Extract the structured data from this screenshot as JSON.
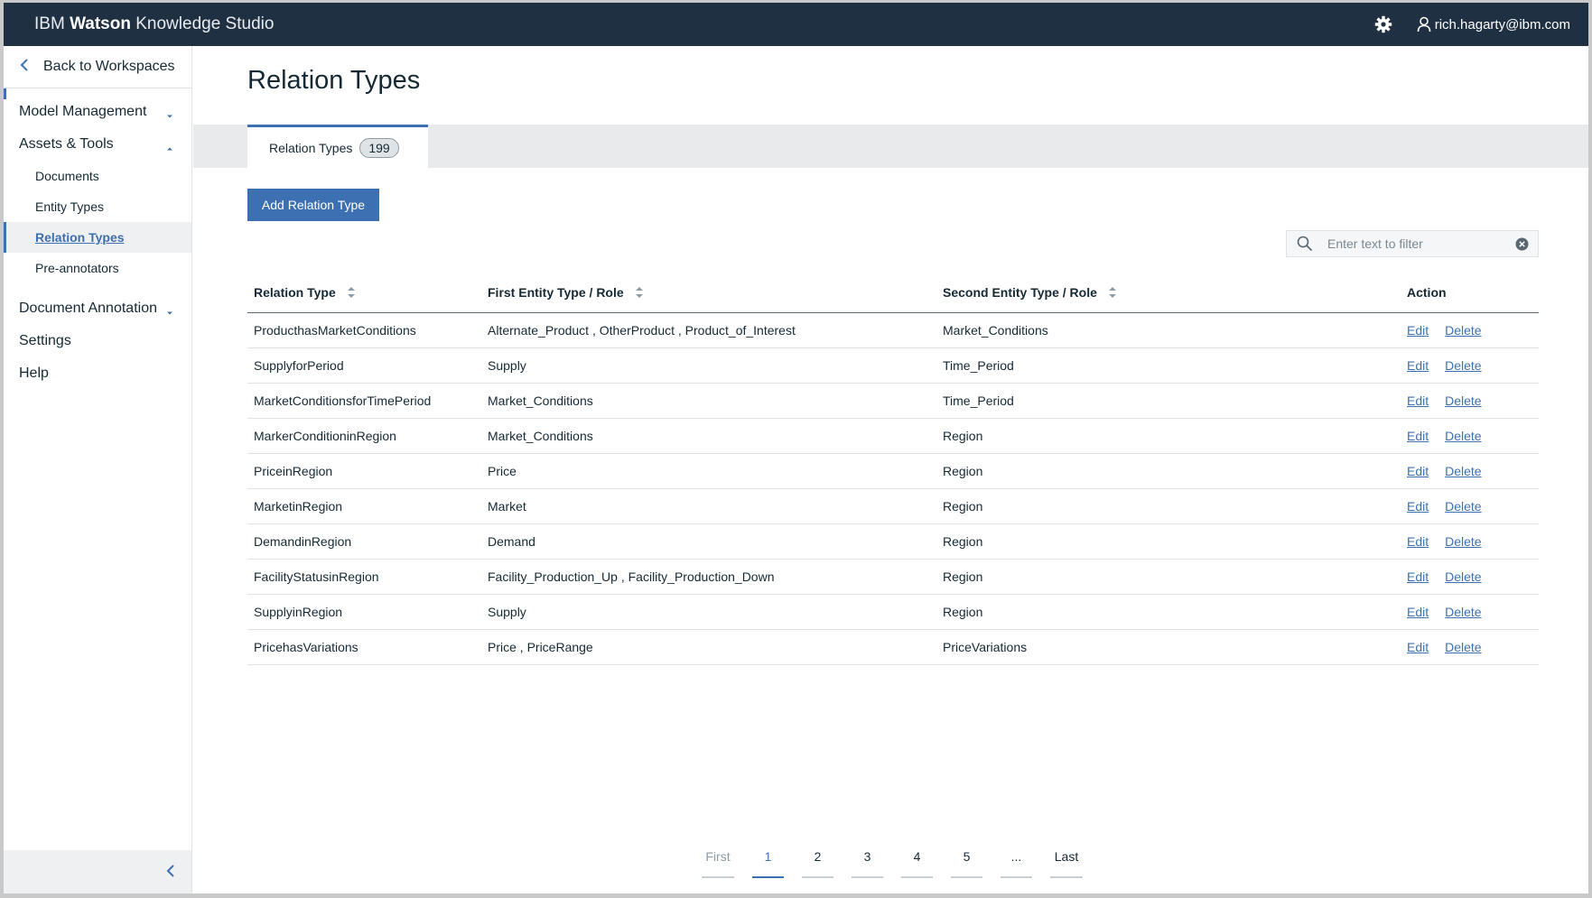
{
  "header": {
    "brand_prefix": "IBM",
    "brand_bold": "Watson",
    "brand_suffix": "Knowledge Studio",
    "user_email": "rich.hagarty@ibm.com"
  },
  "sidebar": {
    "back_label": "Back to Workspaces",
    "model_management": "Model Management",
    "assets_tools": "Assets & Tools",
    "items": {
      "documents": "Documents",
      "entity_types": "Entity Types",
      "relation_types": "Relation Types",
      "pre_annotators": "Pre-annotators"
    },
    "document_annotation": "Document Annotation",
    "settings": "Settings",
    "help": "Help"
  },
  "main": {
    "title": "Relation Types",
    "tab_label": "Relation Types",
    "tab_count": "199",
    "add_button": "Add Relation Type",
    "filter_placeholder": "Enter text to filter",
    "columns": {
      "relation_type": "Relation Type",
      "first_entity": "First Entity Type / Role",
      "second_entity": "Second Entity Type / Role",
      "action": "Action"
    },
    "edit_label": "Edit",
    "delete_label": "Delete",
    "rows": [
      {
        "relation": "ProducthasMarketConditions",
        "first": "Alternate_Product , OtherProduct , Product_of_Interest",
        "second": "Market_Conditions"
      },
      {
        "relation": "SupplyforPeriod",
        "first": "Supply",
        "second": "Time_Period"
      },
      {
        "relation": "MarketConditionsforTimePeriod",
        "first": "Market_Conditions",
        "second": "Time_Period"
      },
      {
        "relation": "MarkerConditioninRegion",
        "first": "Market_Conditions",
        "second": "Region"
      },
      {
        "relation": "PriceinRegion",
        "first": "Price",
        "second": "Region"
      },
      {
        "relation": "MarketinRegion",
        "first": "Market",
        "second": "Region"
      },
      {
        "relation": "DemandinRegion",
        "first": "Demand",
        "second": "Region"
      },
      {
        "relation": "FacilityStatusinRegion",
        "first": "Facility_Production_Up , Facility_Production_Down",
        "second": "Region"
      },
      {
        "relation": "SupplyinRegion",
        "first": "Supply",
        "second": "Region"
      },
      {
        "relation": "PricehasVariations",
        "first": "Price , PriceRange",
        "second": "PriceVariations"
      }
    ],
    "pagination": {
      "first": "First",
      "pages": [
        "1",
        "2",
        "3",
        "4",
        "5",
        "..."
      ],
      "current": "1",
      "last": "Last"
    }
  },
  "colors": {
    "header_bg": "#1f3042",
    "accent": "#3d70b2",
    "tab_band": "#e8eaec"
  }
}
